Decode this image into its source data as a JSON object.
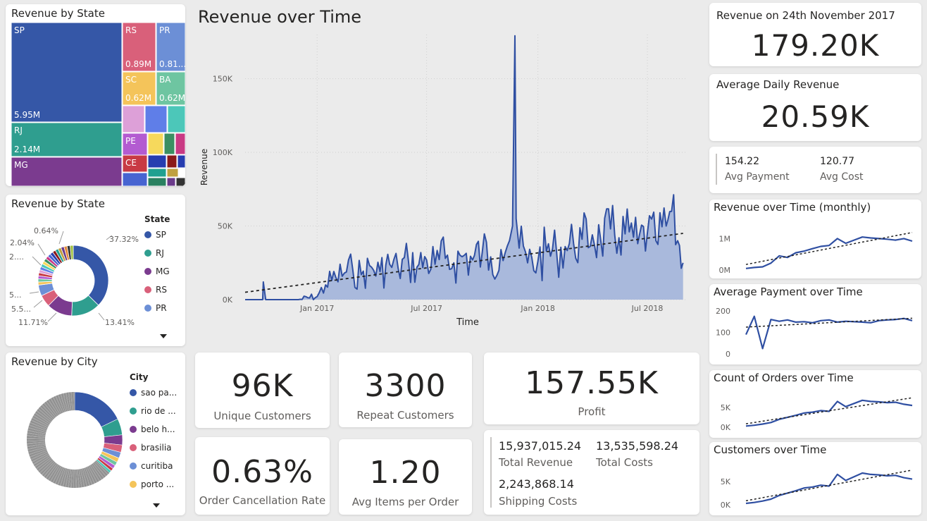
{
  "treemap": {
    "title": "Revenue by State",
    "tiles": [
      {
        "state": "SP",
        "value_label": "5.95M",
        "color": "#3557a7"
      },
      {
        "state": "RJ",
        "value_label": "2.14M",
        "color": "#2f9e8f"
      },
      {
        "state": "MG",
        "value_label": "",
        "color": "#7b3b8f"
      },
      {
        "state": "RS",
        "value_label": "0.89M",
        "color": "#d9607a"
      },
      {
        "state": "PR",
        "value_label": "0.81...",
        "color": "#6c8fd6"
      },
      {
        "state": "SC",
        "value_label": "0.62M",
        "color": "#f4c45a"
      },
      {
        "state": "BA",
        "value_label": "0.62M",
        "color": "#6ec5a1"
      },
      {
        "state": "PE",
        "value_label": "",
        "color": "#b35bd1"
      },
      {
        "state": "CE",
        "value_label": "",
        "color": "#c83a44"
      }
    ]
  },
  "state_donut": {
    "title": "Revenue by State",
    "legend_title": "State",
    "legend": [
      {
        "label": "SP",
        "color": "#3557a7"
      },
      {
        "label": "RJ",
        "color": "#2f9e8f"
      },
      {
        "label": "MG",
        "color": "#7b3b8f"
      },
      {
        "label": "RS",
        "color": "#d9607a"
      },
      {
        "label": "PR",
        "color": "#6c8fd6"
      }
    ],
    "labels": {
      "sp": "37.32%",
      "rj": "13.41%",
      "mg": "11.71%",
      "rs": "5.5...",
      "pr": "5...",
      "l6": "2....",
      "l7": "2.04%",
      "l8": "0.64%"
    }
  },
  "city_donut": {
    "title": "Revenue by City",
    "legend_title": "City",
    "legend": [
      {
        "label": "sao pa...",
        "color": "#3557a7"
      },
      {
        "label": "rio de ...",
        "color": "#2f9e8f"
      },
      {
        "label": "belo h...",
        "color": "#7b3b8f"
      },
      {
        "label": "brasilia",
        "color": "#d9607a"
      },
      {
        "label": "curitiba",
        "color": "#6c8fd6"
      },
      {
        "label": "porto ...",
        "color": "#f4c45a"
      }
    ]
  },
  "main_chart": {
    "title": "Revenue over Time",
    "xlabel": "Time",
    "ylabel": "Revenue",
    "ytick_labels": [
      "0K",
      "50K",
      "100K",
      "150K"
    ],
    "xtick_labels": [
      "Jan 2017",
      "Jul 2017",
      "Jan 2018",
      "Jul 2018"
    ]
  },
  "kpis": {
    "unique_customers": {
      "value": "96K",
      "label": "Unique Customers"
    },
    "repeat_customers": {
      "value": "3300",
      "label": "Repeat Customers"
    },
    "profit": {
      "value": "157.55K",
      "label": "Profit"
    },
    "cancellation": {
      "value": "0.63%",
      "label": "Order Cancellation Rate"
    },
    "avg_items": {
      "value": "1.20",
      "label": "Avg Items per Order"
    }
  },
  "totals": {
    "total_revenue": {
      "value": "15,937,015.24",
      "label": "Total Revenue"
    },
    "total_costs": {
      "value": "13,535,598.24",
      "label": "Total Costs"
    },
    "shipping_costs": {
      "value": "2,243,868.14",
      "label": "Shipping Costs"
    }
  },
  "right": {
    "revenue_day": {
      "title": "Revenue on 24th November 2017",
      "value": "179.20K"
    },
    "avg_daily": {
      "title": "Average Daily Revenue",
      "value": "20.59K"
    },
    "avg_payment": {
      "value": "154.22",
      "label": "Avg Payment"
    },
    "avg_cost": {
      "value": "120.77",
      "label": "Avg Cost"
    },
    "mini": [
      {
        "title": "Revenue over Time (monthly)",
        "ticks": [
          "1M",
          "0M"
        ]
      },
      {
        "title": "Average Payment over Time",
        "ticks": [
          "200",
          "100",
          "0"
        ]
      },
      {
        "title": "Count of Orders over Time",
        "ticks": [
          "5K",
          "0K"
        ]
      },
      {
        "title": "Customers over Time",
        "ticks": [
          "5K",
          "0K"
        ]
      }
    ]
  },
  "chart_data": [
    {
      "type": "area",
      "title": "Revenue over Time",
      "xlabel": "Time",
      "ylabel": "Revenue",
      "x_range": [
        "2016-09-04",
        "2018-09-03"
      ],
      "ylim": [
        0,
        180000
      ],
      "x": [
        "2016-09-04",
        "2016-10-03",
        "2016-10-04",
        "2016-10-08",
        "2016-11-01",
        "2016-12-01",
        "2017-01-01",
        "2017-01-15",
        "2017-02-01",
        "2017-02-15",
        "2017-03-01",
        "2017-03-15",
        "2017-04-01",
        "2017-04-15",
        "2017-05-01",
        "2017-05-15",
        "2017-06-01",
        "2017-06-15",
        "2017-07-01",
        "2017-07-15",
        "2017-08-01",
        "2017-08-15",
        "2017-09-01",
        "2017-09-15",
        "2017-10-01",
        "2017-10-15",
        "2017-11-01",
        "2017-11-15",
        "2017-11-20",
        "2017-11-24",
        "2017-11-26",
        "2017-12-01",
        "2017-12-15",
        "2018-01-01",
        "2018-01-15",
        "2018-02-01",
        "2018-02-15",
        "2018-03-01",
        "2018-03-15",
        "2018-04-01",
        "2018-04-15",
        "2018-05-01",
        "2018-05-15",
        "2018-06-01",
        "2018-06-15",
        "2018-07-01",
        "2018-07-15",
        "2018-08-01",
        "2018-08-10",
        "2018-08-20",
        "2018-08-29"
      ],
      "series": [
        {
          "values": [
            0,
            0,
            12000,
            0,
            0,
            0,
            2000,
            10000,
            15000,
            18000,
            20000,
            17000,
            22000,
            19000,
            24000,
            21000,
            26000,
            22000,
            27000,
            24000,
            28000,
            25000,
            30000,
            27000,
            32000,
            29000,
            34000,
            40000,
            50000,
            179200,
            55000,
            35000,
            25000,
            26000,
            33000,
            32000,
            36000,
            38000,
            41000,
            44000,
            40000,
            48000,
            42000,
            46000,
            38000,
            45000,
            40000,
            50000,
            60000,
            40000,
            25000
          ]
        }
      ],
      "trendline": {
        "start": 5000,
        "end": 45000
      }
    },
    {
      "type": "line",
      "title": "Revenue over Time (monthly)",
      "y": [
        0.05,
        0.08,
        0.1,
        0.22,
        0.45,
        0.4,
        0.55,
        0.6,
        0.68,
        0.75,
        0.78,
        1.0,
        0.85,
        0.95,
        1.05,
        1.02,
        1.0,
        0.98,
        0.95,
        1.0,
        0.92
      ],
      "ylim": [
        0,
        1.3
      ],
      "unit": "M"
    },
    {
      "type": "line",
      "title": "Average Payment over Time",
      "y": [
        90,
        175,
        25,
        160,
        152,
        158,
        148,
        150,
        145,
        155,
        158,
        148,
        152,
        150,
        148,
        145,
        155,
        158,
        160,
        165,
        155
      ],
      "ylim": [
        0,
        210
      ]
    },
    {
      "type": "line",
      "title": "Count of Orders over Time",
      "y": [
        0.3,
        0.5,
        0.8,
        1.2,
        2.0,
        2.5,
        3.0,
        3.6,
        3.8,
        4.2,
        4.0,
        6.5,
        5.2,
        6.0,
        6.8,
        6.5,
        6.4,
        6.2,
        6.3,
        5.8,
        5.5
      ],
      "ylim": [
        0,
        8
      ],
      "unit": "K"
    },
    {
      "type": "line",
      "title": "Customers over Time",
      "y": [
        0.3,
        0.5,
        0.8,
        1.2,
        2.0,
        2.5,
        3.0,
        3.6,
        3.8,
        4.2,
        4.0,
        6.5,
        5.2,
        6.0,
        6.8,
        6.5,
        6.4,
        6.2,
        6.3,
        5.8,
        5.5
      ],
      "ylim": [
        0,
        8
      ],
      "unit": "K"
    },
    {
      "type": "pie",
      "title": "Revenue by State",
      "categories": [
        "SP",
        "RJ",
        "MG",
        "RS",
        "PR",
        "other"
      ],
      "values": [
        37.32,
        13.41,
        11.71,
        5.5,
        5.0,
        27.06
      ]
    }
  ]
}
